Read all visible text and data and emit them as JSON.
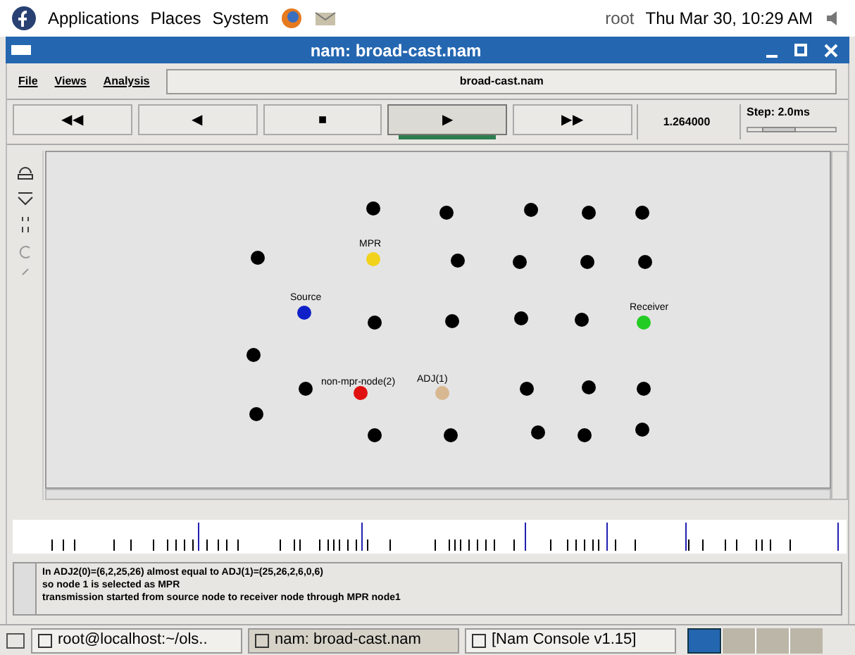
{
  "top_panel": {
    "menus": [
      "Applications",
      "Places",
      "System"
    ],
    "user": "root",
    "clock": "Thu Mar 30, 10:29 AM"
  },
  "window": {
    "title": "nam: broad-cast.nam"
  },
  "menu": [
    "File",
    "Views",
    "Analysis"
  ],
  "file_field": "broad-cast.nam",
  "controls": {
    "buttons": [
      {
        "symbol": "◀◀",
        "selected": false
      },
      {
        "symbol": "◀",
        "selected": false
      },
      {
        "symbol": "■",
        "selected": false
      },
      {
        "symbol": "▶",
        "selected": true
      },
      {
        "symbol": "▶▶",
        "selected": false
      }
    ],
    "time": "1.264000",
    "step": "Step: 2.0ms",
    "step_slider": {
      "level": 0.35
    }
  },
  "nodes": [
    {
      "color": "#000000"
    },
    {
      "color": "#000000"
    },
    {
      "color": "#000000"
    },
    {
      "color": "#000000"
    },
    {
      "color": "#000000"
    },
    {
      "color": "#000000"
    },
    {
      "color": "#f2d21a",
      "label": "MPR"
    },
    {
      "color": "#000000"
    },
    {
      "color": "#000000"
    },
    {
      "color": "#000000"
    },
    {
      "color": "#000000"
    },
    {
      "color": "#1020c8",
      "label": "Source"
    },
    {
      "color": "#000000"
    },
    {
      "color": "#000000"
    },
    {
      "color": "#000000"
    },
    {
      "color": "#000000"
    },
    {
      "color": "#22cc22",
      "label": "Receiver"
    },
    {
      "color": "#000000"
    },
    {
      "color": "#000000"
    },
    {
      "color": "#e01010",
      "label": "non-mpr-node(2)"
    },
    {
      "color": "#d8b890",
      "label": "ADJ(1)"
    },
    {
      "color": "#000000"
    },
    {
      "color": "#000000"
    },
    {
      "color": "#000000"
    },
    {
      "color": "#000000"
    },
    {
      "color": "#000000"
    },
    {
      "color": "#000000"
    },
    {
      "color": "#000000"
    },
    {
      "color": "#000000"
    },
    {
      "color": "#000000"
    }
  ],
  "log": [
    "In ADJ2(0)=(6,2,25,26) almost equal to ADJ(1)=(25,26,2,6,0,6)",
    "so node 1 is selected as MPR",
    "transmission started from source node to receiver node through MPR node1"
  ],
  "taskbar": [
    {
      "label": "root@localhost:~/ols..",
      "selected": false
    },
    {
      "label": "nam: broad-cast.nam",
      "selected": true
    },
    {
      "label": "[Nam Console v1.15]",
      "selected": false
    }
  ]
}
